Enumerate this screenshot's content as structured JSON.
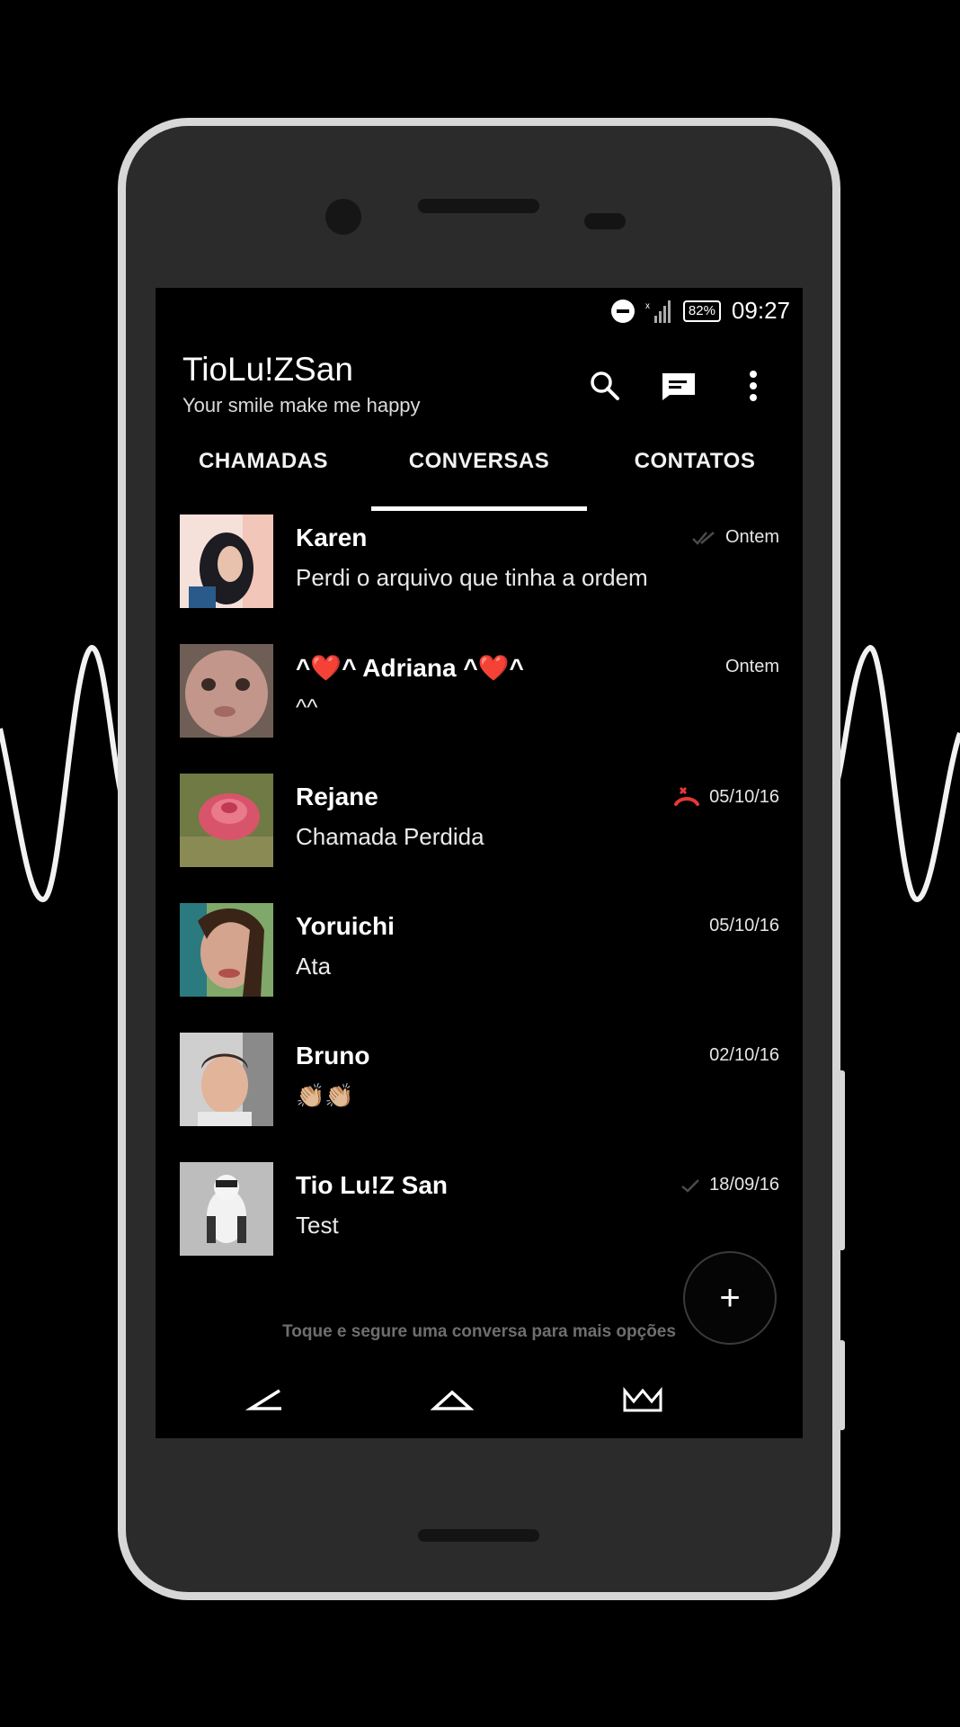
{
  "status_bar": {
    "battery": "82%",
    "time": "09:27",
    "icons": [
      "do-not-disturb-icon",
      "signal-icon",
      "battery-icon"
    ]
  },
  "header": {
    "title": "TioLu!ZSan",
    "subtitle": "Your smile make me happy",
    "actions": [
      "search-icon",
      "new-message-icon",
      "more-vert-icon"
    ]
  },
  "tabs": [
    {
      "label": "CHAMADAS",
      "active": false
    },
    {
      "label": "CONVERSAS",
      "active": true
    },
    {
      "label": "CONTATOS",
      "active": false
    }
  ],
  "conversations": [
    {
      "name": "Karen",
      "preview": "Perdi o arquivo que tinha a ordem",
      "date": "Ontem",
      "status_icon": "double-check-icon"
    },
    {
      "name": "^❤️^ Adriana ^❤️^",
      "preview": "^^",
      "date": "Ontem",
      "status_icon": ""
    },
    {
      "name": "Rejane",
      "preview": "Chamada Perdida",
      "date": "05/10/16",
      "status_icon": "missed-call-icon"
    },
    {
      "name": "Yoruichi",
      "preview": "Ata",
      "date": "05/10/16",
      "status_icon": ""
    },
    {
      "name": "Bruno",
      "preview": "👏🏼👏🏼",
      "date": "02/10/16",
      "status_icon": ""
    },
    {
      "name": "Tio Lu!Z San",
      "preview": "Test",
      "date": "18/09/16",
      "status_icon": "single-check-icon"
    }
  ],
  "hint": "Toque e segure uma conversa para mais opções",
  "fab": {
    "label": "+",
    "icon": "plus-icon"
  },
  "nav": [
    "back-icon",
    "home-icon",
    "crown-icon"
  ],
  "colors": {
    "background": "#000000",
    "phone_body": "#2b2b2b",
    "phone_frame": "#d7d7d7",
    "missed_call": "#e53935",
    "hint_text": "#6e6e6e"
  }
}
